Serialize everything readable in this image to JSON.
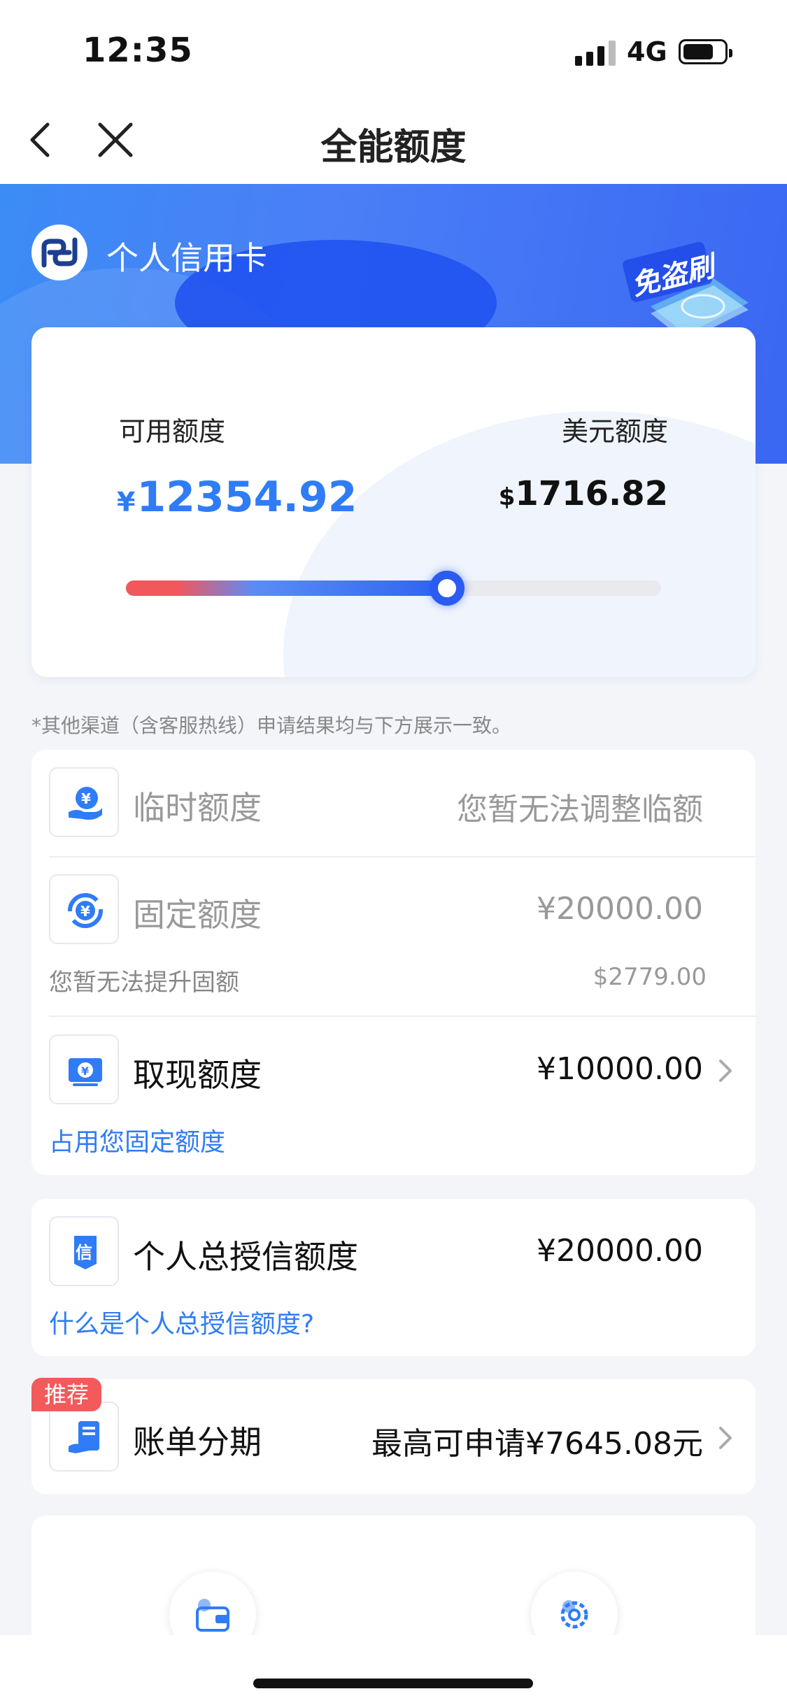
{
  "status_bar": {
    "time": "12:35",
    "network": "4G"
  },
  "nav": {
    "title": "全能额度"
  },
  "hero": {
    "card_type": "个人信用卡",
    "promo_badge_text": "免盗刷"
  },
  "limit_card": {
    "available_label": "可用额度",
    "available_currency": "¥",
    "available_amount": "12354.92",
    "usd_label": "美元额度",
    "usd_currency": "$",
    "usd_amount": "1716.82",
    "usage_fraction": 0.6
  },
  "notice": "*其他渠道（含客服热线）申请结果均与下方展示一致。",
  "temp_limit": {
    "label": "临时额度",
    "value": "您暂无法调整临额"
  },
  "fixed_limit": {
    "label": "固定额度",
    "value": "¥20000.00",
    "note": "您暂无法提升固额",
    "usd_value": "$2779.00"
  },
  "cash_limit": {
    "label": "取现额度",
    "value": "¥10000.00",
    "link": "占用您固定额度"
  },
  "total_credit": {
    "label": "个人总授信额度",
    "value": "¥20000.00",
    "link": "什么是个人总授信额度?"
  },
  "installment": {
    "tag": "推荐",
    "label": "账单分期",
    "value": "最高可申请¥7645.08元"
  },
  "colors": {
    "accent": "#2f7cf6",
    "tag_red": "#f25a5c",
    "hero_blue": "#4a7ff7"
  },
  "icons": [
    "chevron-left-icon",
    "close-icon",
    "bank-logo-icon",
    "yuan-hand-icon",
    "yuan-cycle-icon",
    "yuan-cash-icon",
    "credit-doc-icon",
    "installment-icon",
    "wallet-icon",
    "gear-icon"
  ]
}
